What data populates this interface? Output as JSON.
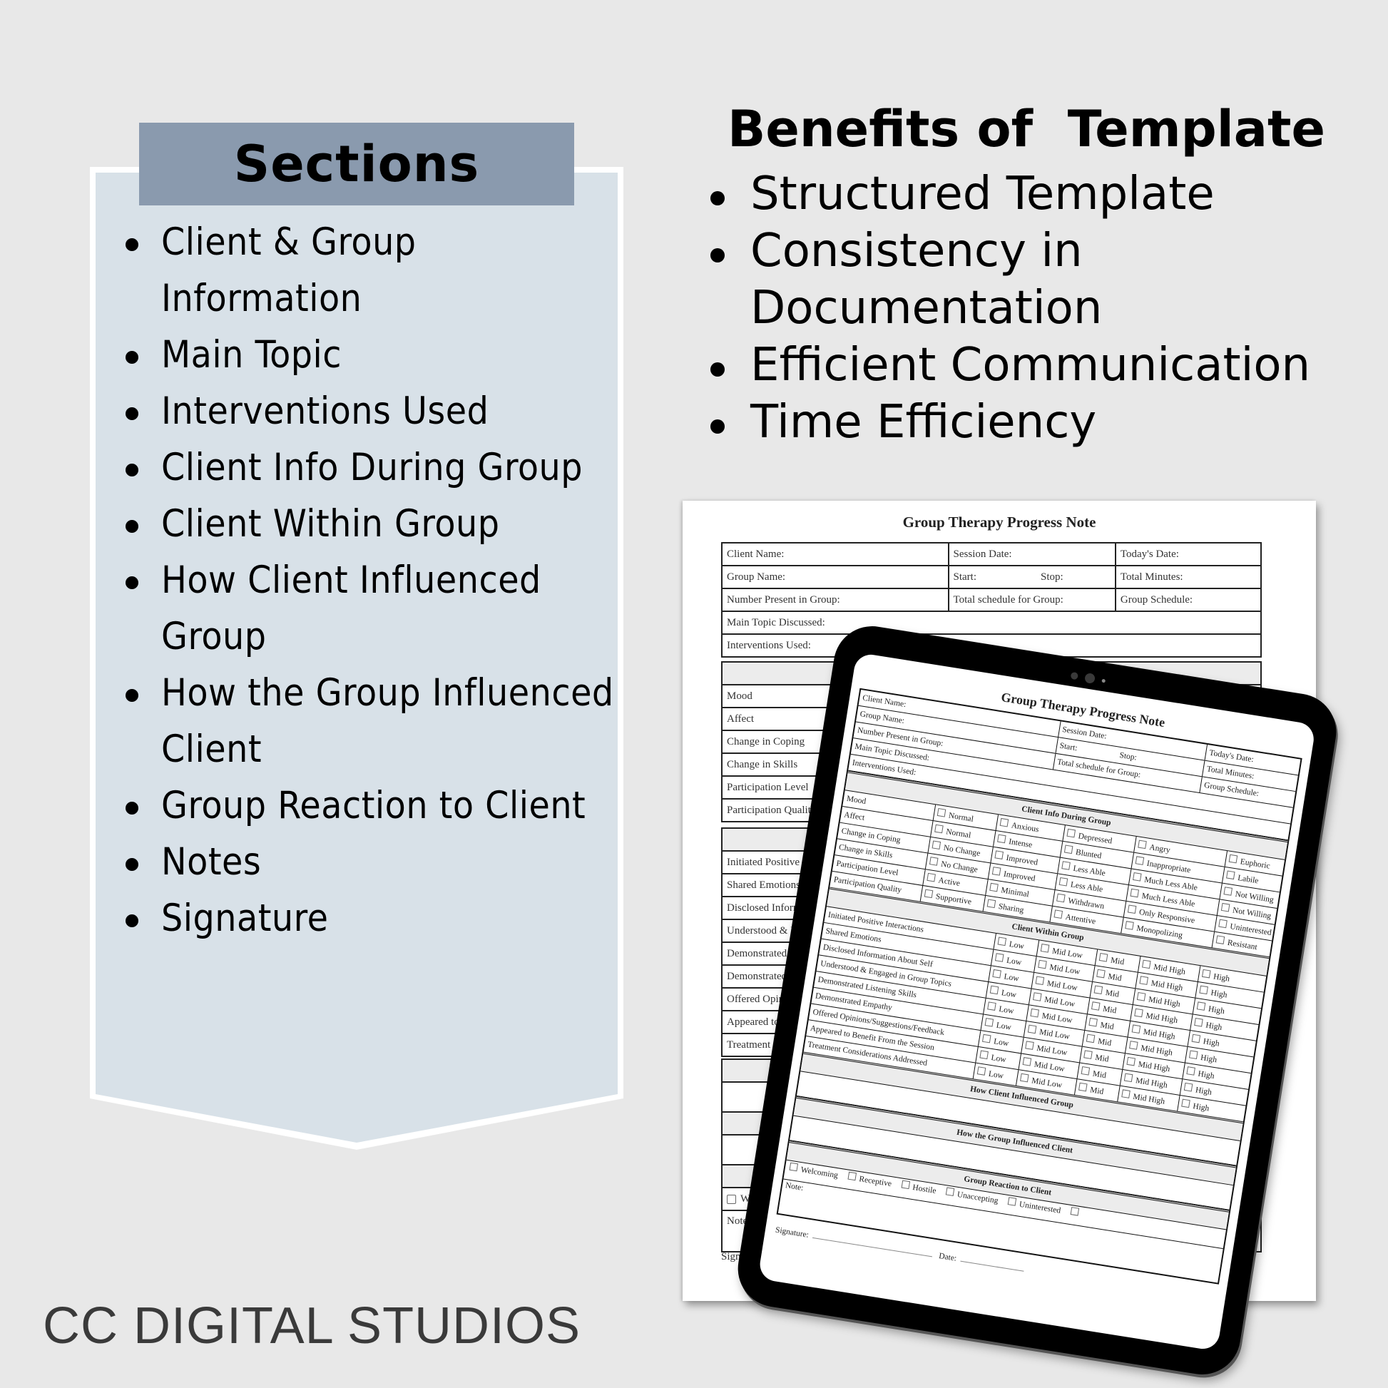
{
  "colors": {
    "background": "#e8e8e8",
    "panel_fill": "#d8e1e8",
    "header_fill": "#8a9aae",
    "brand_text": "#3a3a3a"
  },
  "sections": {
    "title": "Sections",
    "items": [
      "Client & Group Information",
      "Main Topic",
      "Interventions Used",
      "Client Info During Group",
      "Client Within Group",
      "How Client Influenced Group",
      "How the Group Influenced Client",
      "Group Reaction to Client",
      "Notes",
      "Signature"
    ]
  },
  "benefits": {
    "title": "Benefits of  Template",
    "items": [
      "Structured Template",
      "Consistency in Documentation",
      "Efficient Communication",
      "Time Efficiency"
    ]
  },
  "brand": "CC DIGITAL STUDIOS",
  "form": {
    "title": "Group Therapy Progress Note",
    "fields": {
      "client_name": "Client Name:",
      "session_date": "Session Date:",
      "todays_date": "Today's Date:",
      "group_name": "Group Name:",
      "start": "Start:",
      "stop": "Stop:",
      "total_minutes": "Total Minutes:",
      "number_present": "Number Present in Group:",
      "total_schedule": "Total schedule for Group:",
      "group_schedule": "Group Schedule:",
      "main_topic": "Main Topic Discussed:",
      "interventions": "Interventions Used:"
    },
    "client_info_heading": "Client Info During Group",
    "client_info_rows": [
      {
        "label": "Mood",
        "options": [
          "Normal",
          "Anxious",
          "Depressed",
          "Angry",
          "Euphoric"
        ]
      },
      {
        "label": "Affect",
        "options": [
          "Normal",
          "Intense",
          "Blunted",
          "Inappropriate",
          "Labile"
        ]
      },
      {
        "label": "Change in Coping",
        "options": [
          "No Change",
          "Improved",
          "Less Able",
          "Much Less Able",
          "Not Willing"
        ]
      },
      {
        "label": "Change in Skills",
        "options": [
          "No Change",
          "Improved",
          "Less Able",
          "Much Less Able",
          "Not Willing"
        ]
      },
      {
        "label": "Participation Level",
        "options": [
          "Active",
          "Minimal",
          "Withdrawn",
          "Only Responsive",
          "Uninterested"
        ]
      },
      {
        "label": "Participation Quality",
        "options": [
          "Supportive",
          "Sharing",
          "Attentive",
          "Monopolizing",
          "Resistant"
        ]
      }
    ],
    "client_within_heading": "Client Within Group",
    "rating_options": [
      "Low",
      "Mid Low",
      "Mid",
      "Mid High",
      "High"
    ],
    "client_within_rows": [
      "Initiated Positive Interactions",
      "Shared Emotions",
      "Disclosed Information About Self",
      "Understood & Engaged in Group Topics",
      "Demonstrated Listening Skills",
      "Demonstrated Empathy",
      "Offered Opinions/Suggestions/Feedback",
      "Appeared to Benefit From the Session",
      "Treatment Considerations Addressed"
    ],
    "client_influenced_heading": "How Client Influenced Group",
    "group_influenced_heading": "How the Group Influenced Client",
    "reaction_heading": "Group Reaction to Client",
    "reaction_options": [
      "Welcoming",
      "Receptive",
      "Hostile",
      "Unaccepting",
      "Uninterested",
      ""
    ],
    "note_label": "Note:",
    "signature_label": "Signature:",
    "date_label": "Date:"
  }
}
